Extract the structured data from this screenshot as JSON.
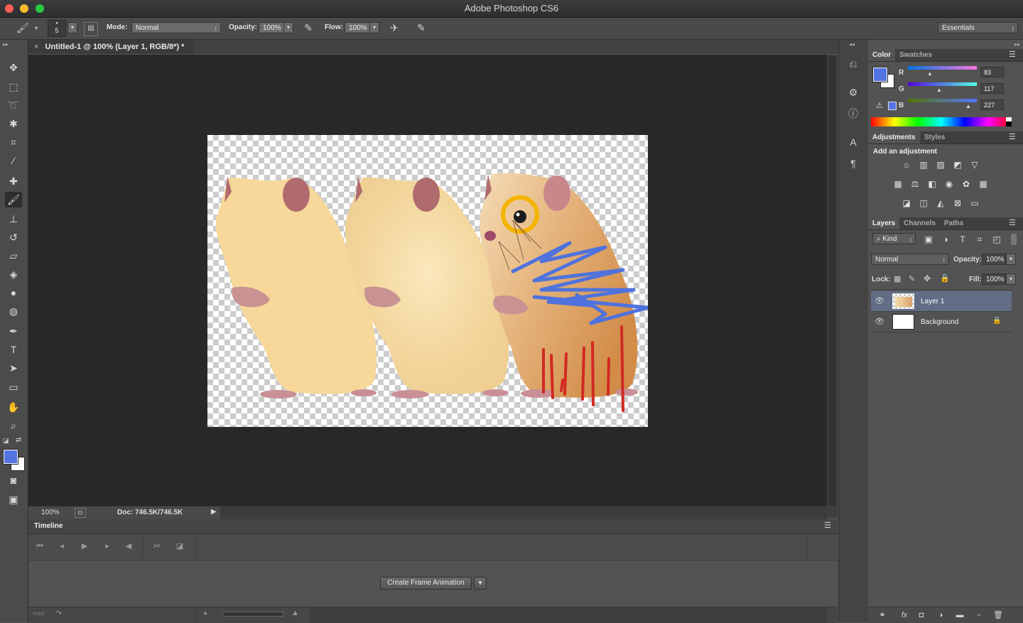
{
  "app": {
    "title": "Adobe Photoshop CS6"
  },
  "options_bar": {
    "brush_size": "5",
    "mode_label": "Mode:",
    "mode_value": "Normal",
    "opacity_label": "Opacity:",
    "opacity_value": "100%",
    "flow_label": "Flow:",
    "flow_value": "100%",
    "workspace": "Essentials"
  },
  "document": {
    "tab_title": "Untitled-1 @ 100% (Layer 1, RGB/8*) *",
    "close_glyph": "×",
    "zoom": "100%",
    "doc_info": "Doc: 746.5K/746.5K"
  },
  "timeline": {
    "title": "Timeline",
    "create_button": "Create Frame Animation"
  },
  "color_panel": {
    "tabs": [
      "Color",
      "Swatches"
    ],
    "r_label": "R",
    "g_label": "G",
    "b_label": "B",
    "r_value": "83",
    "g_value": "117",
    "b_value": "227",
    "foreground": "#5375e3",
    "background": "#ffffff"
  },
  "adjustments_panel": {
    "tabs": [
      "Adjustments",
      "Styles"
    ],
    "heading": "Add an adjustment"
  },
  "layers_panel": {
    "tabs": [
      "Layers",
      "Channels",
      "Paths"
    ],
    "kind_filter": "Kind",
    "blend_mode": "Normal",
    "opacity_label": "Opacity:",
    "opacity_value": "100%",
    "lock_label": "Lock:",
    "fill_label": "Fill:",
    "fill_value": "100%",
    "layers": [
      {
        "name": "Layer 1"
      },
      {
        "name": "Background"
      }
    ]
  },
  "tools": [
    "move-tool",
    "marquee-tool",
    "lasso-tool",
    "magic-wand-tool",
    "crop-tool",
    "eyedropper-tool",
    "healing-brush-tool",
    "brush-tool",
    "clone-stamp-tool",
    "history-brush-tool",
    "eraser-tool",
    "paint-bucket-tool",
    "blur-tool",
    "dodge-tool",
    "pen-tool",
    "type-tool",
    "path-selection-tool",
    "shape-tool",
    "hand-tool",
    "zoom-tool"
  ]
}
